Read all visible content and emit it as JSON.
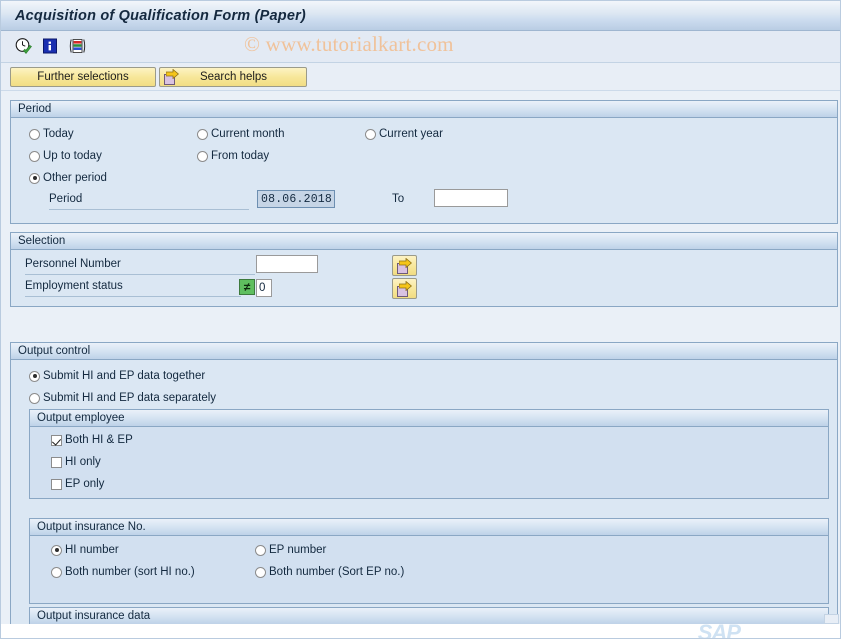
{
  "window": {
    "title": "Acquisition of Qualification Form (Paper)"
  },
  "toolbar": {
    "icons": [
      {
        "name": "execute-clock-icon",
        "title": "Execute"
      },
      {
        "name": "info-icon",
        "title": "Information"
      },
      {
        "name": "color-bars-icon",
        "title": "Layout"
      }
    ],
    "watermark": "© www.tutorialkart.com"
  },
  "buttons": {
    "further_selections": "Further selections",
    "search_helps": "Search helps"
  },
  "period": {
    "title": "Period",
    "options": [
      {
        "label": "Today",
        "selected": false
      },
      {
        "label": "Current month",
        "selected": false
      },
      {
        "label": "Current year",
        "selected": false
      },
      {
        "label": "Up to today",
        "selected": false
      },
      {
        "label": "From today",
        "selected": false
      },
      {
        "label": "Other period",
        "selected": true
      }
    ],
    "period_label": "Period",
    "period_value": "08.06.2018",
    "to_label": "To",
    "to_value": ""
  },
  "selection": {
    "title": "Selection",
    "personnel_number_label": "Personnel Number",
    "personnel_number_value": "",
    "personnel_number_placeholder": "",
    "employment_status_label": "Employment status",
    "employment_status_operator": "≠",
    "employment_status_value": "0"
  },
  "output_control": {
    "title": "Output control",
    "options": [
      {
        "label": "Submit HI and EP data together",
        "selected": true
      },
      {
        "label": "Submit HI and EP data separately",
        "selected": false
      }
    ],
    "output_employee": {
      "title": "Output employee",
      "items": [
        {
          "label": "Both HI & EP",
          "checked": true
        },
        {
          "label": "HI only",
          "checked": false
        },
        {
          "label": "EP only",
          "checked": false
        }
      ]
    },
    "output_insurance_no": {
      "title": "Output insurance No.",
      "items": [
        {
          "label": "HI number",
          "selected": true
        },
        {
          "label": "EP number",
          "selected": false
        },
        {
          "label": "Both number (sort HI no.)",
          "selected": false
        },
        {
          "label": "Both number (Sort EP no.)",
          "selected": false
        }
      ]
    },
    "output_insurance_data": {
      "title": "Output insurance data"
    }
  },
  "branding": {
    "logo": "SAP"
  },
  "colors": {
    "title_text": "#15293f",
    "panel_bg": "#dbe7f3",
    "panel_border": "#8aa7c4",
    "button_yellow": "#f7e79a",
    "watermark": "#f0c29a",
    "operator_green": "#5fbf5f",
    "date_field_bg": "#c6d5e6"
  }
}
